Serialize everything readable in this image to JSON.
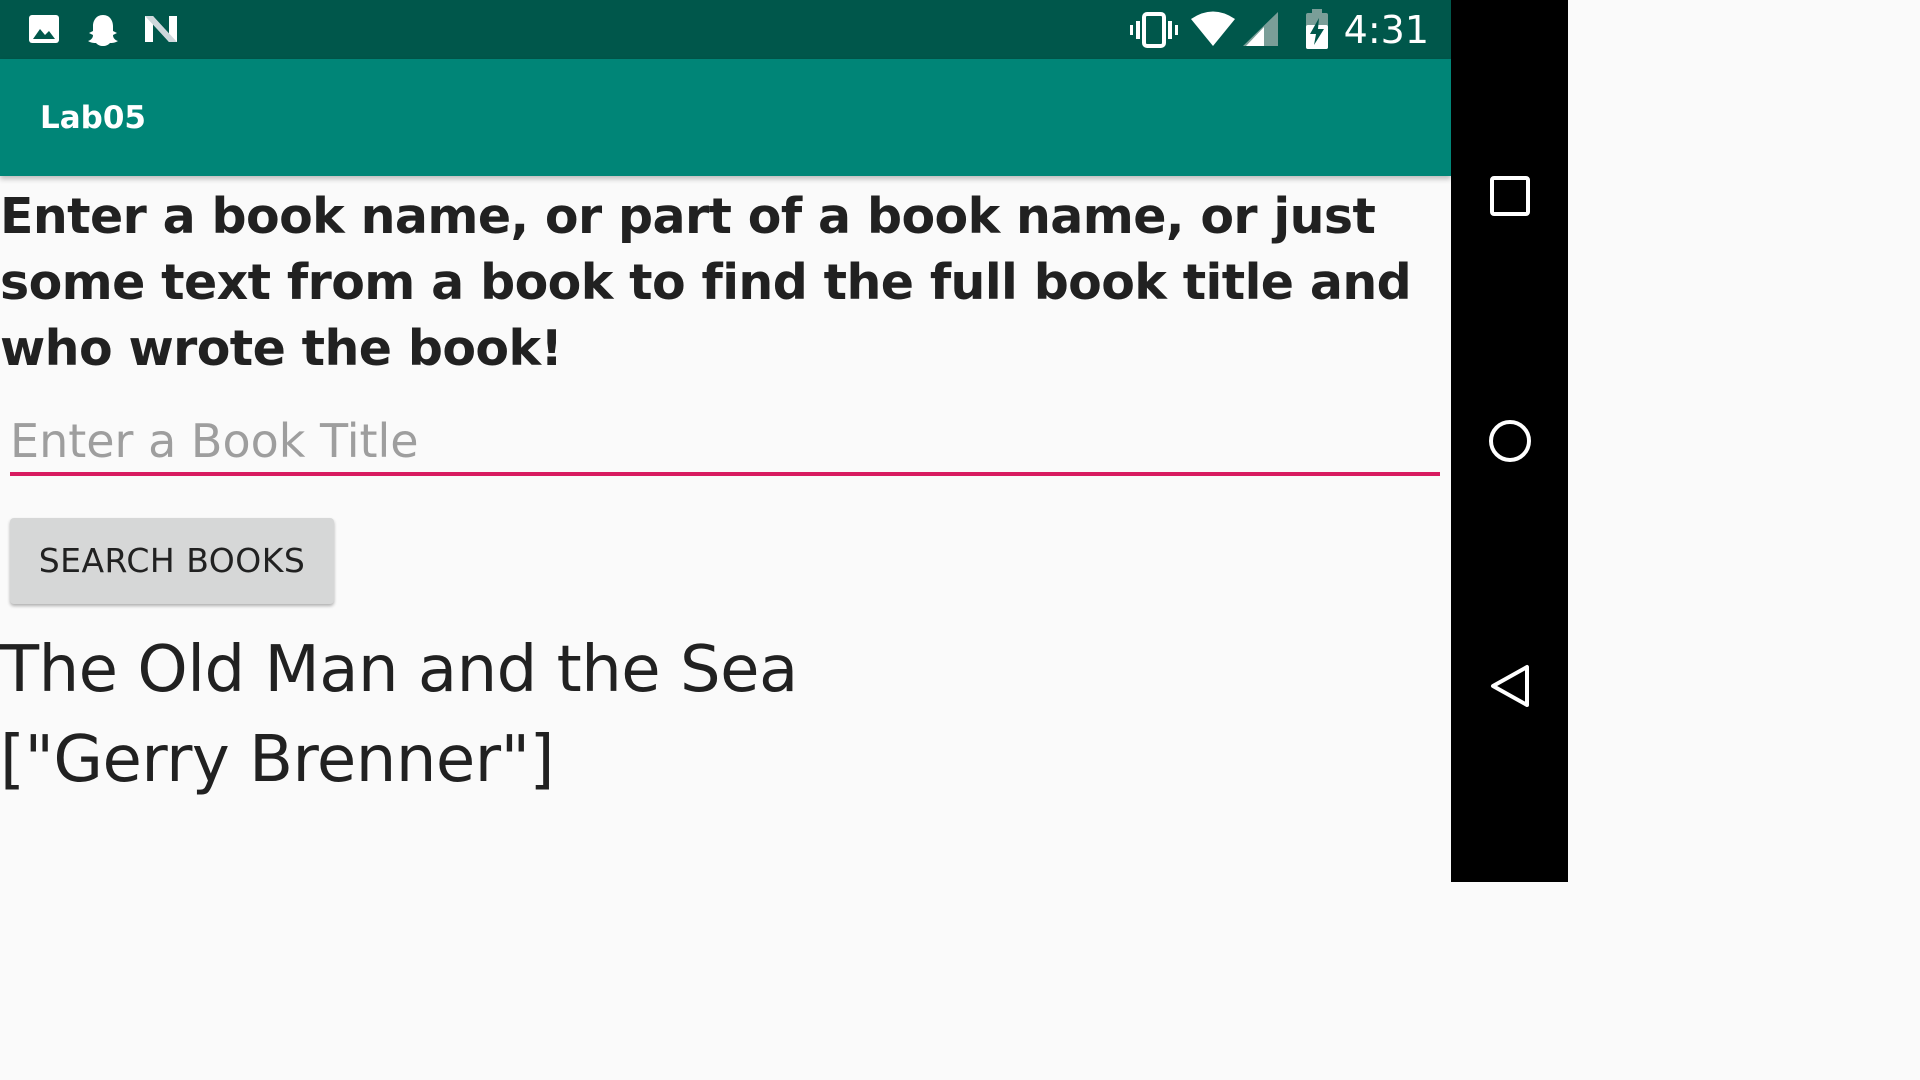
{
  "status_bar": {
    "left_icons": [
      "image-icon",
      "ghost-icon",
      "n-icon"
    ],
    "right_icons": [
      "vibrate-icon",
      "wifi-icon",
      "signal-icon",
      "battery-charging-icon"
    ],
    "time": "4:31"
  },
  "app_bar": {
    "title": "Lab05"
  },
  "main": {
    "instructions": "Enter a book name, or part of a book name, or just some text from a book to find the full book title and who wrote the book!",
    "input_placeholder": "Enter a Book Title",
    "input_value": "",
    "search_button_label": "SEARCH BOOKS",
    "result_title": "The Old Man and the Sea",
    "result_author": "[\"Gerry Brenner\"]"
  },
  "nav_bar": {
    "buttons": [
      "recents-icon",
      "home-icon",
      "back-icon"
    ]
  },
  "colors": {
    "status_bar": "#00574b",
    "app_bar": "#008577",
    "accent": "#d81b60",
    "button": "#d6d7d7"
  }
}
